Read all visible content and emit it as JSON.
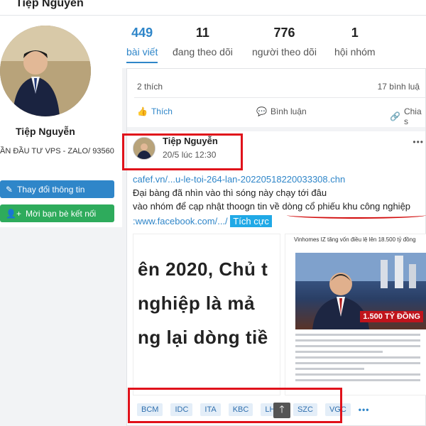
{
  "header": {
    "name": "Tiệp Nguyễn"
  },
  "profile": {
    "name": "Tiệp Nguyễn",
    "bio": "ẦN ĐẦU TƯ VPS - ZALO/ 93560",
    "btn_edit": "Thay đổi thông tin",
    "btn_invite": "Mời bạn bè kết nối"
  },
  "stats": [
    {
      "num": "449",
      "label": "bài viết"
    },
    {
      "num": "11",
      "label": "đang theo dõi"
    },
    {
      "num": "776",
      "label": "người theo dõi"
    },
    {
      "num": "1",
      "label": "hội nhóm"
    }
  ],
  "post_summary": {
    "likes": "2 thích",
    "comments": "17 bình luậ",
    "like_btn": "Thích",
    "comment_btn": "Bình luận",
    "share_btn": "Chia s"
  },
  "post": {
    "author": "Tiệp Nguyễn",
    "time": "20/5 lúc 12:30",
    "more": "•••",
    "link1": "cafef.vn/...u-le-toi-264-lan-20220518220033308.chn",
    "line1": "Đại bàng đã nhìn vào thì sóng này chạy tới đâu",
    "line2_a": "vào nhóm để cạp nhật thoogn tin về dòng ",
    "line2_b": "cổ phiếu khu công nghiệp",
    "link2": ":www.facebook.com/.../",
    "tag": "Tích cực",
    "image_left_lines": [
      "ên 2020, Chủ t",
      "nghiệp là mả",
      "ng lại dòng tiề"
    ],
    "image_right_headline": "Vinhomes IZ tăng vốn điều lệ lên 18.500 tỷ đồng",
    "image_right_banner": "1.500 TỶ ĐỒNG"
  },
  "stocks": [
    "BCM",
    "IDC",
    "ITA",
    "KBC",
    "LHG",
    "SZC",
    "VGC"
  ],
  "stocks_more": "•••",
  "colors": {
    "accent": "#2f86c9",
    "green": "#2eab5c",
    "annotation": "#e0121b",
    "tag": "#20a9e6"
  }
}
